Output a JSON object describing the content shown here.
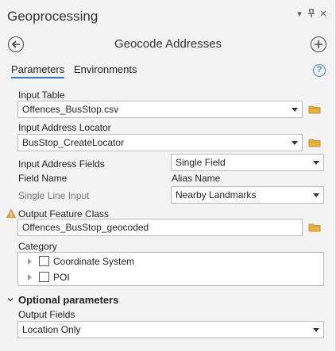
{
  "window": {
    "title": "Geoprocessing",
    "pin_glyph": "▾",
    "pin_icon_glyph": "⊣",
    "close_glyph": "✕"
  },
  "header": {
    "tool_title": "Geocode Addresses"
  },
  "tabs": [
    {
      "label": "Parameters",
      "active": true
    },
    {
      "label": "Environments",
      "active": false
    }
  ],
  "help_glyph": "?",
  "params": {
    "input_table_label": "Input Table",
    "input_table_value": "Offences_BusStop.csv",
    "address_locator_label": "Input Address Locator",
    "address_locator_value": "BusStop_CreateLocator",
    "address_fields_label": "Input Address Fields",
    "address_fields_value": "Single Field",
    "field_name_header": "Field Name",
    "alias_name_header": "Alias Name",
    "single_line_label": "Single Line Input",
    "single_line_value": "Nearby Landmarks",
    "output_fc_label": "Output Feature Class",
    "output_fc_value": "Offences_BusStop_geocoded",
    "category_label": "Category",
    "categories": [
      "Coordinate System",
      "POI"
    ]
  },
  "optional": {
    "section_label": "Optional parameters",
    "output_fields_label": "Output Fields",
    "output_fields_value": "Location Only"
  },
  "colors": {
    "accent": "#2b78c2",
    "folder": "#e8b33a",
    "warning": "#e8a33a"
  },
  "icons": {
    "back": "back-arrow-icon",
    "add": "plus-circle-icon",
    "folder": "folder-icon",
    "warning": "warning-icon",
    "help": "help-icon"
  }
}
